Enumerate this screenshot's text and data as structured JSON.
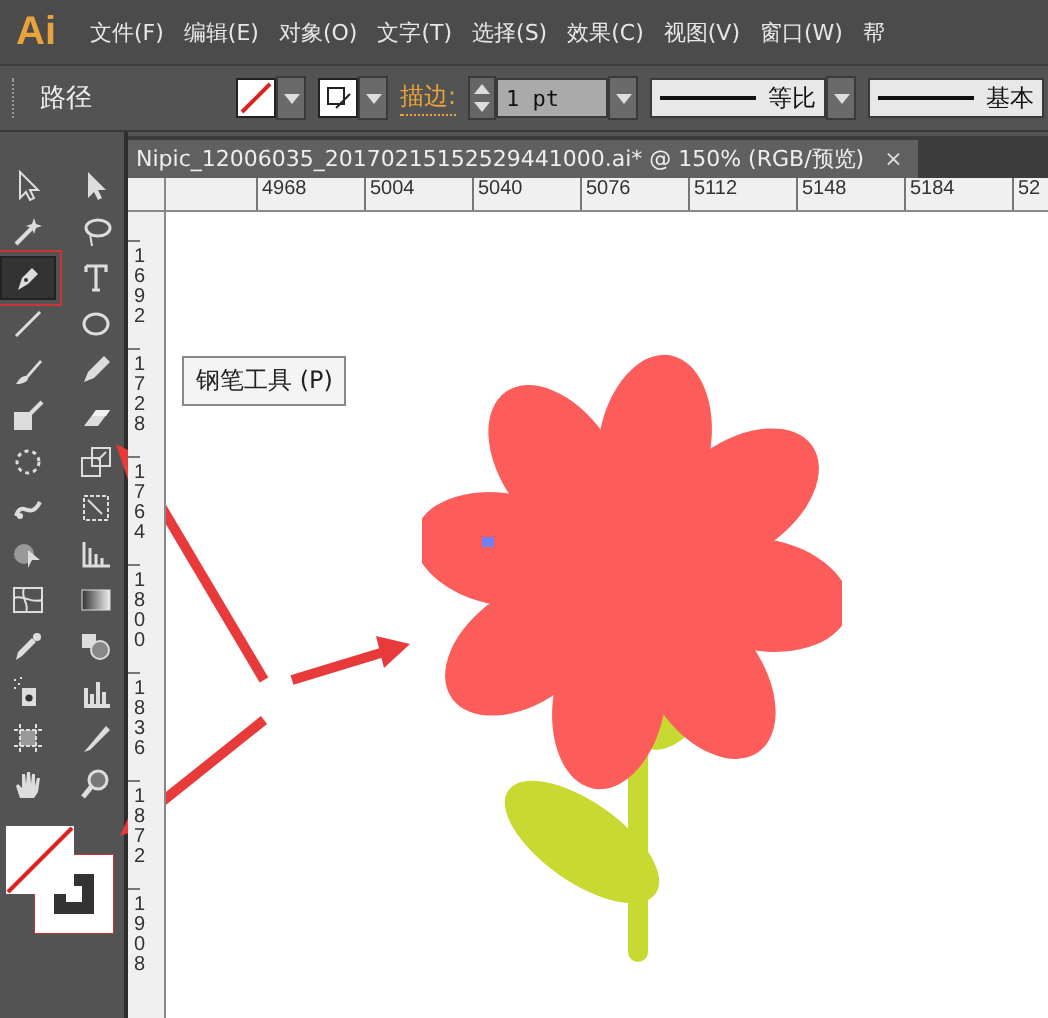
{
  "app": {
    "logo": "Ai"
  },
  "menu": [
    "文件(F)",
    "编辑(E)",
    "对象(O)",
    "文字(T)",
    "选择(S)",
    "效果(C)",
    "视图(V)",
    "窗口(W)",
    "帮"
  ],
  "control_bar": {
    "selection": "路径",
    "stroke_label": "描边:",
    "stroke_weight": "1 pt",
    "profile": "等比",
    "brush": "基本"
  },
  "document_tab": {
    "title": "Nipic_12006035_20170215152529441000.ai*  @  150%  (RGB/预览)",
    "close": "×"
  },
  "ruler_h": [
    "4968",
    "5004",
    "5040",
    "5076",
    "5112",
    "5148",
    "5184",
    "52"
  ],
  "ruler_v": [
    "1692",
    "1728",
    "1764",
    "1800",
    "1836",
    "1872",
    "1908"
  ],
  "tools": [
    {
      "selected": false
    },
    {
      "selected": false
    },
    {
      "selected": false
    },
    {
      "selected": false
    },
    {
      "selected": true
    },
    {
      "selected": false
    },
    {
      "selected": false
    },
    {
      "selected": false
    },
    {
      "selected": false
    },
    {
      "selected": false
    },
    {
      "selected": false
    },
    {
      "selected": false
    },
    {
      "selected": false
    },
    {
      "selected": false
    },
    {
      "selected": false
    },
    {
      "selected": false
    },
    {
      "selected": false
    },
    {
      "selected": false
    },
    {
      "selected": false
    },
    {
      "selected": false
    },
    {
      "selected": false
    },
    {
      "selected": false
    },
    {
      "selected": false
    },
    {
      "selected": false
    },
    {
      "selected": false
    },
    {
      "selected": false
    },
    {
      "selected": false
    },
    {
      "selected": false
    }
  ],
  "tooltip": "钢笔工具 (P)"
}
